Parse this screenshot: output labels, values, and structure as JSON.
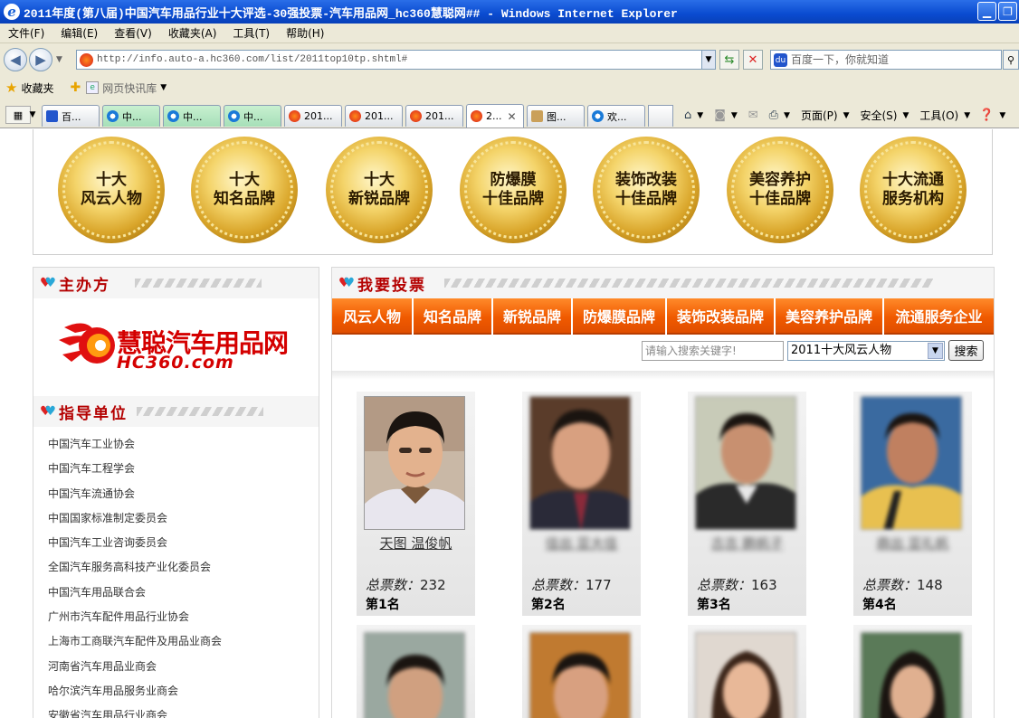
{
  "window": {
    "title": "2011年度(第八届)中国汽车用品行业十大评选-30强投票-汽车用品网_hc360慧聪网## - Windows Internet Explorer"
  },
  "menu": [
    "文件(F)",
    "编辑(E)",
    "查看(V)",
    "收藏夹(A)",
    "工具(T)",
    "帮助(H)"
  ],
  "address": {
    "url": "http://info.auto-a.hc360.com/list/2011top10tp.shtml#",
    "search_placeholder": "百度一下，你就知道"
  },
  "favorites": {
    "label": "收藏夹",
    "quick_link": "网页快讯库"
  },
  "tabs": [
    {
      "label": "百...",
      "icon": "baidu"
    },
    {
      "label": "中...",
      "icon": "ie"
    },
    {
      "label": "中...",
      "icon": "ie"
    },
    {
      "label": "中...",
      "icon": "ie"
    },
    {
      "label": "201...",
      "icon": "hc"
    },
    {
      "label": "201...",
      "icon": "hc"
    },
    {
      "label": "201...",
      "icon": "hc"
    },
    {
      "label": "2...",
      "icon": "hc"
    },
    {
      "label": "图...",
      "icon": "img"
    },
    {
      "label": "欢...",
      "icon": "ie"
    }
  ],
  "command_bar": {
    "page": "页面(P)",
    "safety": "安全(S)",
    "tools": "工具(O)"
  },
  "awards": [
    "十大风云人物",
    "十大知名品牌",
    "十大新锐品牌",
    "防爆膜十佳品牌",
    "装饰改装十佳品牌",
    "美容养护十佳品牌",
    "十大流通服务机构"
  ],
  "awards_lines": [
    [
      "十大",
      "风云人物"
    ],
    [
      "十大",
      "知名品牌"
    ],
    [
      "十大",
      "新锐品牌"
    ],
    [
      "防爆膜",
      "十佳品牌"
    ],
    [
      "装饰改装",
      "十佳品牌"
    ],
    [
      "美容养护",
      "十佳品牌"
    ],
    [
      "十大流通",
      "服务机构"
    ]
  ],
  "sponsor": {
    "heading": "主办方",
    "logo_cn": "慧聪汽车用品网",
    "logo_en": "HC360.com"
  },
  "guidance": {
    "heading": "指导单位",
    "orgs": [
      "中国汽车工业协会",
      "中国汽车工程学会",
      "中国汽车流通协会",
      "中国国家标准制定委员会",
      "中国汽车工业咨询委员会",
      "全国汽车服务高科技产业化委员会",
      "中国汽车用品联合会",
      "广州市汽车配件用品行业协会",
      "上海市工商联汽车配件及用品业商会",
      "河南省汽车用品业商会",
      "哈尔滨汽车用品服务业商会",
      "安徽省汽车用品行业商会"
    ]
  },
  "vote": {
    "heading": "我要投票",
    "categories": [
      "风云人物",
      "知名品牌",
      "新锐品牌",
      "防爆膜品牌",
      "装饰改装品牌",
      "美容养护品牌",
      "流通服务企业"
    ],
    "search_placeholder": "请输入搜索关键字!",
    "selected_category": "2011十大风云人物",
    "search_button": "搜索",
    "votes_label": "总票数：",
    "candidates": [
      {
        "name": "天图 温俊帆",
        "votes": "232",
        "rank": "第1名"
      },
      {
        "name": "佳出 亚大佳",
        "votes": "177",
        "rank": "第2名"
      },
      {
        "name": "古吉 鹏帆子",
        "votes": "163",
        "rank": "第3名"
      },
      {
        "name": "鼎出 亚礼帆",
        "votes": "148",
        "rank": "第4名"
      }
    ]
  },
  "colors": {
    "title_blue": "#0a4bd0",
    "heading_red": "#b40000",
    "tab_orange": "#f05a00",
    "medal_gold": "#d9a52a"
  }
}
